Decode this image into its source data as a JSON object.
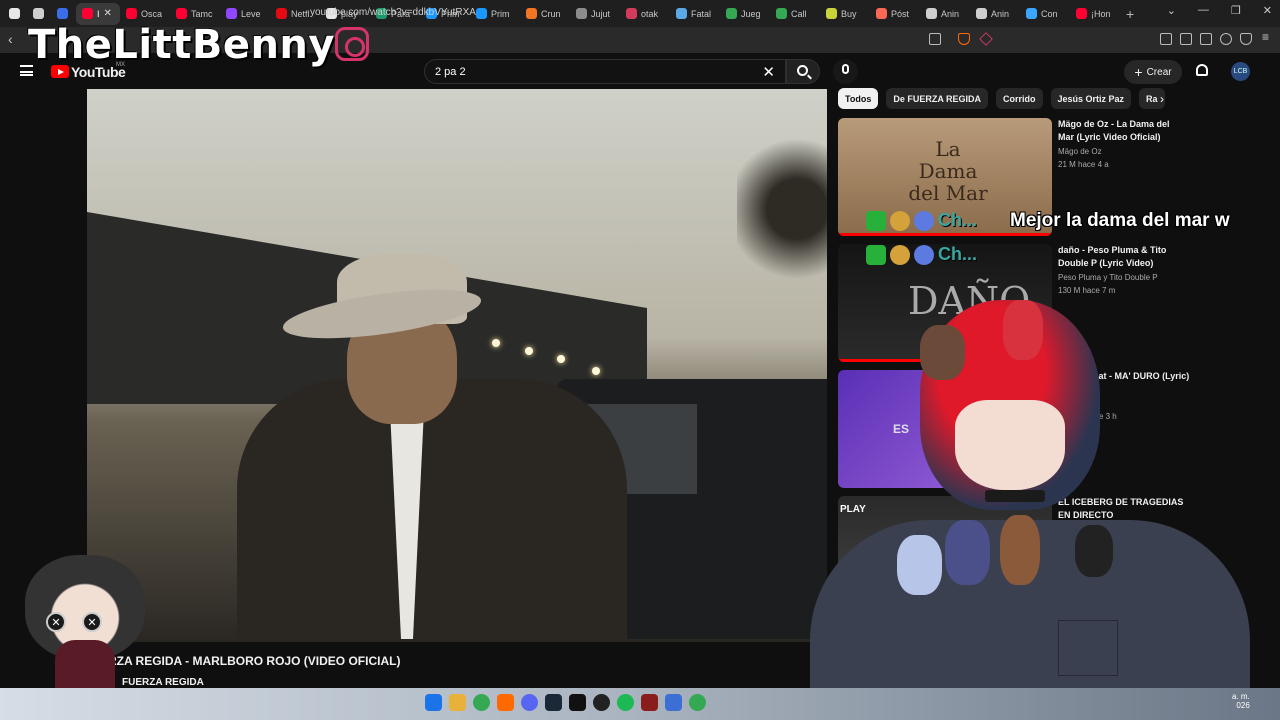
{
  "browser": {
    "tabs": [
      {
        "label": "",
        "pinned": true,
        "color": "#e8e8e8",
        "icon": "bug-icon"
      },
      {
        "label": "",
        "pinned": true,
        "color": "#cfcfcf",
        "icon": "anchor-icon"
      },
      {
        "label": "",
        "pinned": true,
        "color": "#3a6ee8",
        "icon": "w-icon"
      },
      {
        "label": "I",
        "active": true,
        "color": "#ff0033",
        "icon": "youtube-icon"
      },
      {
        "label": "Osca",
        "color": "#ff0033",
        "icon": "youtube-icon"
      },
      {
        "label": "Tamc",
        "color": "#ff0033",
        "icon": "youtube-icon"
      },
      {
        "label": "Leve",
        "color": "#9146ff",
        "icon": "twitch-icon"
      },
      {
        "label": "Netfl",
        "color": "#e50914",
        "icon": "netflix-icon"
      },
      {
        "label": "play",
        "color": "#e8e8e8",
        "icon": "play-icon"
      },
      {
        "label": "Para",
        "color": "#1d9a6c",
        "icon": "leaf-icon"
      },
      {
        "label": "Prim",
        "color": "#1a98ff",
        "icon": "prime-icon"
      },
      {
        "label": "Prim",
        "color": "#1a98ff",
        "icon": "prime-icon"
      },
      {
        "label": "Crun",
        "color": "#f47521",
        "icon": "crunchyroll-icon"
      },
      {
        "label": "Jujut",
        "color": "#8c8c8c",
        "icon": "af-icon"
      },
      {
        "label": "otak",
        "color": "#d43b5a",
        "icon": "otaku-icon"
      },
      {
        "label": "Fatal",
        "color": "#5aa9e6",
        "icon": "image-icon"
      },
      {
        "label": "Jueg",
        "color": "#34a853",
        "icon": "google-icon"
      },
      {
        "label": "Call",
        "color": "#34a853",
        "icon": "google-icon"
      },
      {
        "label": "Buy",
        "color": "#c9d33a",
        "icon": "buy-icon"
      },
      {
        "label": "Póst",
        "color": "#f96854",
        "icon": "patreon-icon"
      },
      {
        "label": "Anin",
        "color": "#cfcfcf",
        "icon": "figure-icon"
      },
      {
        "label": "Anin",
        "color": "#cfcfcf",
        "icon": "figure-icon"
      },
      {
        "label": "Con",
        "color": "#3aa6ff",
        "icon": "doc-icon"
      },
      {
        "label": "¡Hon",
        "color": "#ff0033",
        "icon": "youtube-icon"
      }
    ],
    "url": "youtube.com/watch?v=ddkbVYutRXA"
  },
  "watermark": "TheLittBenny",
  "youtube": {
    "brand": "YouTube",
    "region": "MX",
    "search_value": "2 pa 2",
    "create_label": "Crear",
    "avatar_text": "LCB"
  },
  "video": {
    "title": "ERZA REGIDA - MARLBORO ROJO (VIDEO OFICIAL)",
    "channel": "FUERZA REGIDA"
  },
  "chips": [
    "Todos",
    "De FUERZA REGIDA",
    "Corrido",
    "Jesús Ortiz Paz",
    "Ra"
  ],
  "recommendations": [
    {
      "title": "Mägo de Oz - La Dama del Mar (Lyric Video Oficial)",
      "channel": "Mägo de Oz",
      "meta": "21 M   hace 4 a",
      "thumb_text": "La Dama del Mar"
    },
    {
      "title": "daño - Peso Pluma & Tito Double P (Lyric Video)",
      "channel": "Peso Pluma y Tito Double P",
      "meta": "130 M   hace 7 m",
      "thumb_text": "DAÑO"
    },
    {
      "title": "Goat - MA' DURO (Lyric)",
      "channel": "",
      "meta": "hace 3 h",
      "thumb_text": "ES"
    },
    {
      "title": "EL ICEBERG DE TRAGEDIAS EN DIRECTO",
      "channel": "",
      "meta": "",
      "thumb_text": "PLAY"
    }
  ],
  "chat": {
    "message": "Mejor la dama del mar w",
    "username": "Ch..."
  },
  "taskbar": {
    "clock": "a. m.\n026"
  }
}
